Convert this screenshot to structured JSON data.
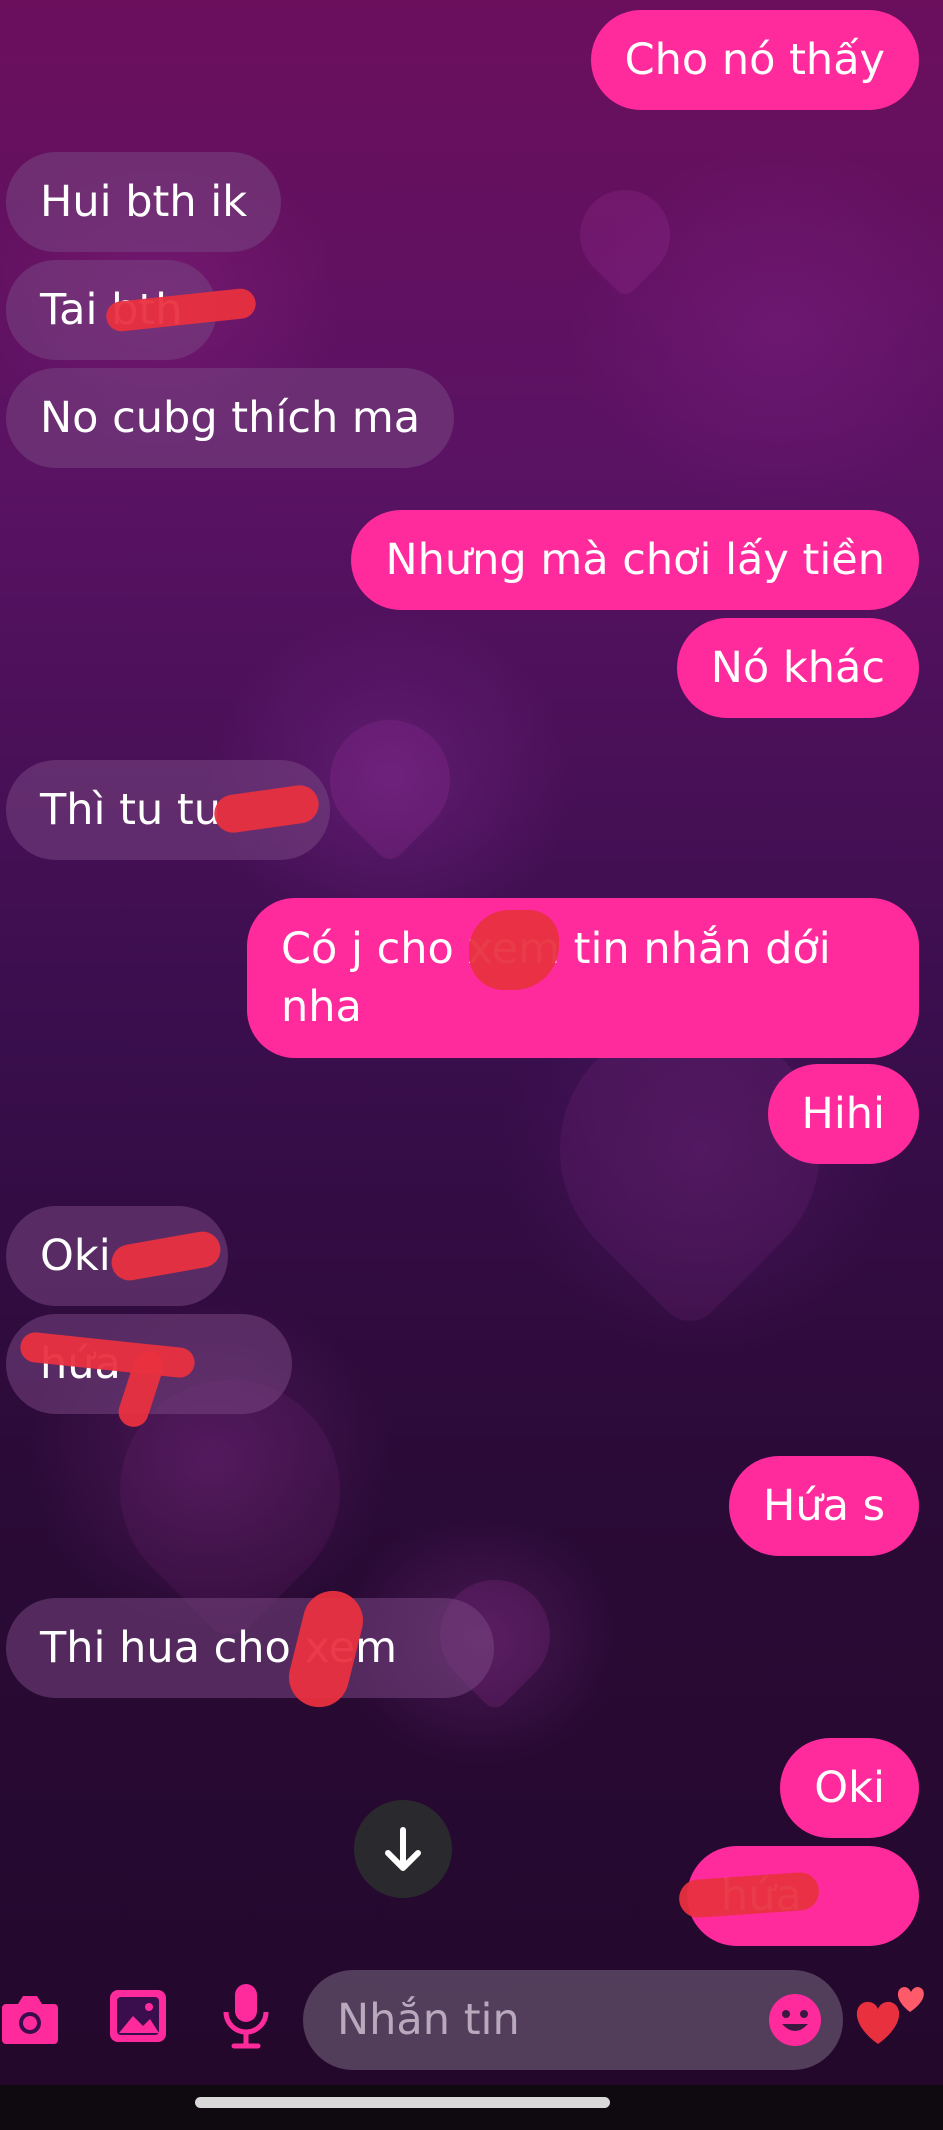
{
  "messages": [
    {
      "dir": "out",
      "text": "Cho nó thấy"
    },
    {
      "dir": "in",
      "text": "Hui bth ik"
    },
    {
      "dir": "in",
      "text": "Tai          bth"
    },
    {
      "dir": "in",
      "text": "No cubg thích ma"
    },
    {
      "dir": "out",
      "text": "Nhưng mà chơi lấy tiền"
    },
    {
      "dir": "out",
      "text": "Nó khác"
    },
    {
      "dir": "in",
      "text": "Thì tu tu"
    },
    {
      "dir": "out",
      "text_line1": "Có j cho        xem tin nhắn dới",
      "text_line2": "nha"
    },
    {
      "dir": "out",
      "text": "Hihi"
    },
    {
      "dir": "in",
      "text": "Oki"
    },
    {
      "dir": "in",
      "text": "           hứa"
    },
    {
      "dir": "out",
      "text": "Hứa s"
    },
    {
      "dir": "in",
      "text": "Thi hua cho          xem"
    },
    {
      "dir": "out",
      "text": "Oki"
    },
    {
      "dir": "out",
      "text": "        hứa"
    }
  ],
  "composer": {
    "placeholder": "Nhắn tin",
    "icons": [
      "camera-icon",
      "image-icon",
      "microphone-icon",
      "emoji-icon",
      "hearts-icon"
    ]
  },
  "scroll_button_icon": "arrow-down-icon",
  "colors": {
    "outgoing": "#ff2a9c",
    "incoming": "#78468a",
    "accent": "#ff2a9c"
  }
}
